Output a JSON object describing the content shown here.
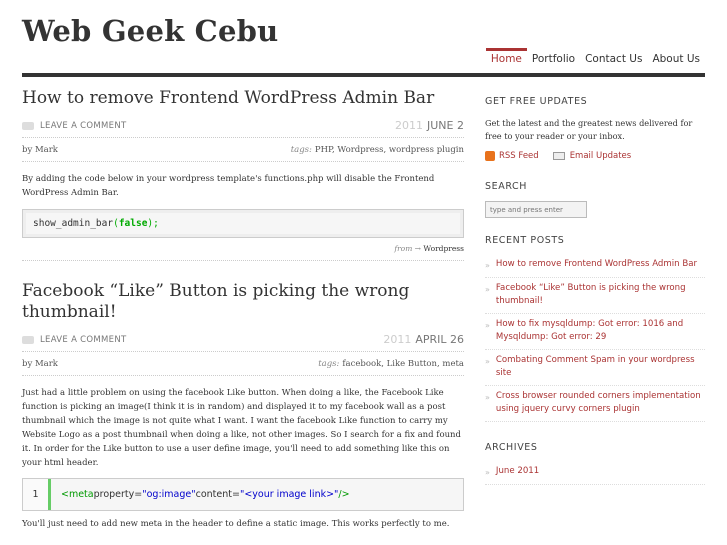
{
  "site": {
    "title": "Web Geek Cebu"
  },
  "nav": {
    "items": [
      "Home",
      "Portfolio",
      "Contact Us",
      "About Us"
    ],
    "active_index": 0
  },
  "posts": [
    {
      "title": "How to remove Frontend WordPress Admin Bar",
      "comment_label": "LEAVE A COMMENT",
      "year": "2011",
      "date": "JUNE 2",
      "author": "by Mark",
      "tags_label": "tags:",
      "tags": "PHP, Wordpress, wordpress plugin",
      "body": "By adding the code below in your wordpress template's functions.php will disable the Frontend WordPress Admin Bar.",
      "code": {
        "fn": "show_admin_bar",
        "open": "(",
        "arg": "false",
        "close": ");"
      },
      "from_label": "from →",
      "category": "Wordpress"
    },
    {
      "title": "Facebook “Like” Button is picking the wrong thumbnail!",
      "comment_label": "LEAVE A COMMENT",
      "year": "2011",
      "date": "APRIL 26",
      "author": "by Mark",
      "tags_label": "tags:",
      "tags": "facebook, Like Button, meta",
      "body": "Just had a little problem on using the facebook Like button. When doing a like, the Facebook Like function is picking an image(I think it is in random) and displayed it to my facebook wall as a post thumbnail which the image is not quite what I want. I want the facebook Like function to carry my Website Logo as a post thumbnail when doing a like, not other images. So I search for a fix and found it. In order for the Like button to use a user define image, you'll need to add something like this on your html header.",
      "code": {
        "line_number": "1",
        "open": "<meta",
        "attr1": " property=",
        "val1": "\"og:image\"",
        "attr2": " content=",
        "val2": "\"<your image link>\"",
        "close": "/>"
      },
      "body2": "You'll just need to add new meta in the header to define a static image. This works perfectly to me."
    }
  ],
  "sidebar": {
    "updates": {
      "title": "GET FREE UPDATES",
      "text": "Get the latest and the greatest news delivered for free to your reader or your inbox.",
      "rss_label": "RSS Feed",
      "email_label": "Email Updates"
    },
    "search": {
      "title": "SEARCH",
      "placeholder": "type and press enter"
    },
    "recent": {
      "title": "RECENT POSTS",
      "items": [
        "How to remove Frontend WordPress Admin Bar",
        "Facebook “Like” Button is picking the wrong thumbnail!",
        "How to fix mysqldump: Got error: 1016 and Mysqldump: Got error: 29",
        "Combating Comment Spam in your wordpress site",
        "Cross browser rounded corners implementation using jquery curvy corners plugin"
      ]
    },
    "archives": {
      "title": "ARCHIVES",
      "items": [
        "June 2011"
      ]
    }
  }
}
